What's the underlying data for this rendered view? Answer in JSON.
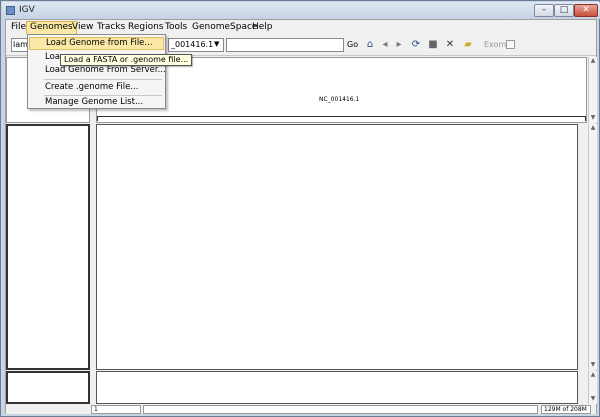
{
  "window": {
    "title": "IGV",
    "minimize_glyph": "–",
    "maximize_glyph": "□",
    "close_glyph": "✕"
  },
  "menubar": {
    "items": [
      "File",
      "Genomes",
      "View",
      "Tracks",
      "Regions",
      "Tools",
      "GenomeSpace",
      "Help"
    ],
    "open_menu": "Genomes"
  },
  "genomes_menu": {
    "items": [
      {
        "label": "Load Genome from File...",
        "highlighted": true
      },
      {
        "label": "Load Genome from URL...",
        "highlighted": false
      },
      {
        "label": "Load Genome From Server...",
        "highlighted": false
      },
      {
        "label": "Create .genome File...",
        "highlighted": false
      },
      {
        "label": "Manage Genome List...",
        "highlighted": false
      }
    ],
    "visible_labels": [
      "Load Genome from File...",
      "Loa",
      "Load Genome From Server...",
      "Create .genome File...",
      "Manage Genome List..."
    ]
  },
  "tooltip": {
    "text": "Load a FASTA or .genome file..."
  },
  "toolbar": {
    "genome_value": "lamb",
    "locus_value": "_001416.1",
    "search_value": "",
    "go_label": "Go",
    "icons": [
      "home-icon",
      "back-icon",
      "forward-icon",
      "refresh-icon",
      "roi-icon",
      "close-icon",
      "popup-text-icon"
    ],
    "exome_label": "Exome"
  },
  "ruler": {
    "chromosome_label": "NC_001416.1"
  },
  "status": {
    "position": "1",
    "memory": "129M of 208M"
  },
  "colors": {
    "highlight": "#fbe8a6",
    "tooltip_bg": "#ffffe1",
    "window_frame": "#c8d4e3"
  }
}
